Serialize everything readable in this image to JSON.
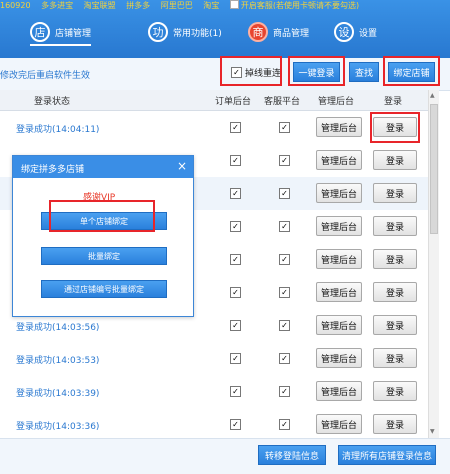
{
  "top_strip": {
    "items": [
      "160920",
      "多多进宝",
      "淘宝联盟",
      "拼多多",
      "阿里巴巴",
      "淘宝",
      "开启客服(若使用卡顿请不要勾选)"
    ]
  },
  "nav": [
    {
      "icon": "店",
      "label": "店铺管理"
    },
    {
      "icon": "功",
      "label": "常用功能(1)"
    },
    {
      "icon": "商",
      "label": "商品管理"
    },
    {
      "icon": "设",
      "label": "设置"
    }
  ],
  "toolbar": {
    "hint": "修改完后重启软件生效",
    "reconnect_label": "掉线重连",
    "one_click_login": "一键登录",
    "search": "查找",
    "bind_shop": "绑定店铺"
  },
  "table": {
    "headers": [
      "登录状态",
      "订单后台",
      "客服平台",
      "管理后台",
      "登录"
    ],
    "manage_label": "管理后台",
    "login_label": "登录",
    "rows": [
      {
        "status": "登录成功(14:04:11)"
      },
      {
        "status": ""
      },
      {
        "status": ""
      },
      {
        "status": ""
      },
      {
        "status": ""
      },
      {
        "status": ""
      },
      {
        "status": "登录成功(14:03:56)"
      },
      {
        "status": "登录成功(14:03:53)"
      },
      {
        "status": "登录成功(14:03:39)"
      },
      {
        "status": "登录成功(14:03:36)"
      }
    ]
  },
  "modal": {
    "title": "绑定拼多多店铺",
    "vip_text": "感谢VIP",
    "single_bind": "单个店铺绑定",
    "batch_bind": "批量绑定",
    "batch_bind_by_id": "通过店铺编号批量绑定"
  },
  "bottom": {
    "transfer_login_info": "转移登陆信息",
    "clear_login_info": "清理所有店铺登录信息"
  }
}
